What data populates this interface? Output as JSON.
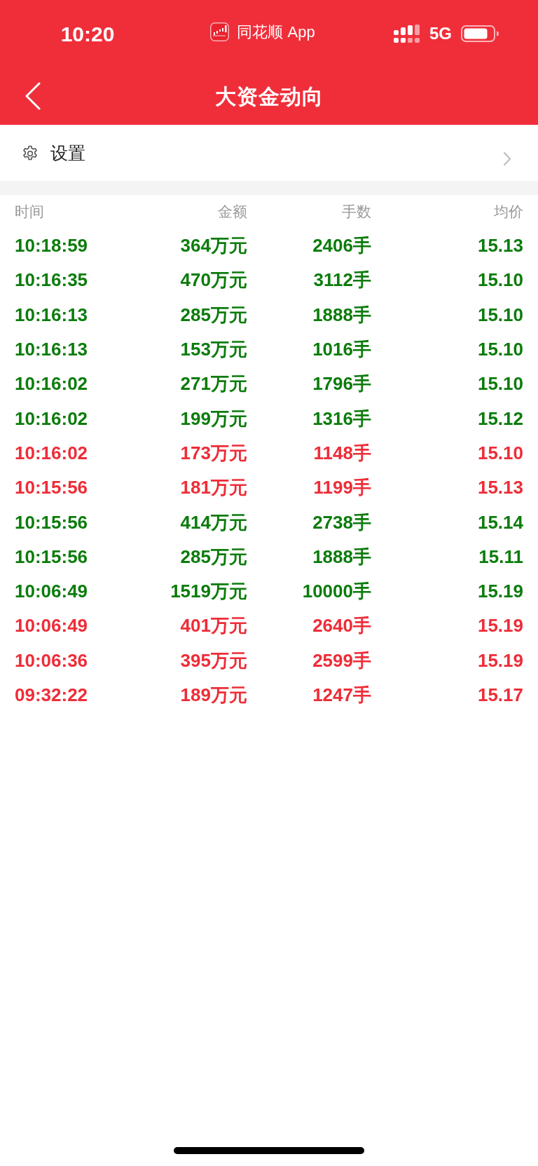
{
  "status_bar": {
    "time": "10:20",
    "app_label": "同花顺 App",
    "network": "5G"
  },
  "nav_bar": {
    "title": "大资金动向"
  },
  "settings_row": {
    "label": "设置"
  },
  "table": {
    "columns": [
      "时间",
      "金额",
      "手数",
      "均价"
    ],
    "rows": [
      {
        "time": "10:18:59",
        "amount": "364万元",
        "lots": "2406手",
        "avg_price": "15.13",
        "color": "#0c7c0c"
      },
      {
        "time": "10:16:35",
        "amount": "470万元",
        "lots": "3112手",
        "avg_price": "15.10",
        "color": "#0c7c0c"
      },
      {
        "time": "10:16:13",
        "amount": "285万元",
        "lots": "1888手",
        "avg_price": "15.10",
        "color": "#0c7c0c"
      },
      {
        "time": "10:16:13",
        "amount": "153万元",
        "lots": "1016手",
        "avg_price": "15.10",
        "color": "#0c7c0c"
      },
      {
        "time": "10:16:02",
        "amount": "271万元",
        "lots": "1796手",
        "avg_price": "15.10",
        "color": "#0c7c0c"
      },
      {
        "time": "10:16:02",
        "amount": "199万元",
        "lots": "1316手",
        "avg_price": "15.12",
        "color": "#0c7c0c"
      },
      {
        "time": "10:16:02",
        "amount": "173万元",
        "lots": "1148手",
        "avg_price": "15.10",
        "color": "#ee2d38"
      },
      {
        "time": "10:15:56",
        "amount": "181万元",
        "lots": "1199手",
        "avg_price": "15.13",
        "color": "#ee2d38"
      },
      {
        "time": "10:15:56",
        "amount": "414万元",
        "lots": "2738手",
        "avg_price": "15.14",
        "color": "#0c7c0c"
      },
      {
        "time": "10:15:56",
        "amount": "285万元",
        "lots": "1888手",
        "avg_price": "15.11",
        "color": "#0c7c0c"
      },
      {
        "time": "10:06:49",
        "amount": "1519万元",
        "lots": "10000手",
        "avg_price": "15.19",
        "color": "#0c7c0c"
      },
      {
        "time": "10:06:49",
        "amount": "401万元",
        "lots": "2640手",
        "avg_price": "15.19",
        "color": "#ee2d38"
      },
      {
        "time": "10:06:36",
        "amount": "395万元",
        "lots": "2599手",
        "avg_price": "15.19",
        "color": "#ee2d38"
      },
      {
        "time": "09:32:22",
        "amount": "189万元",
        "lots": "1247手",
        "avg_price": "15.17",
        "color": "#ee2d38"
      }
    ]
  }
}
